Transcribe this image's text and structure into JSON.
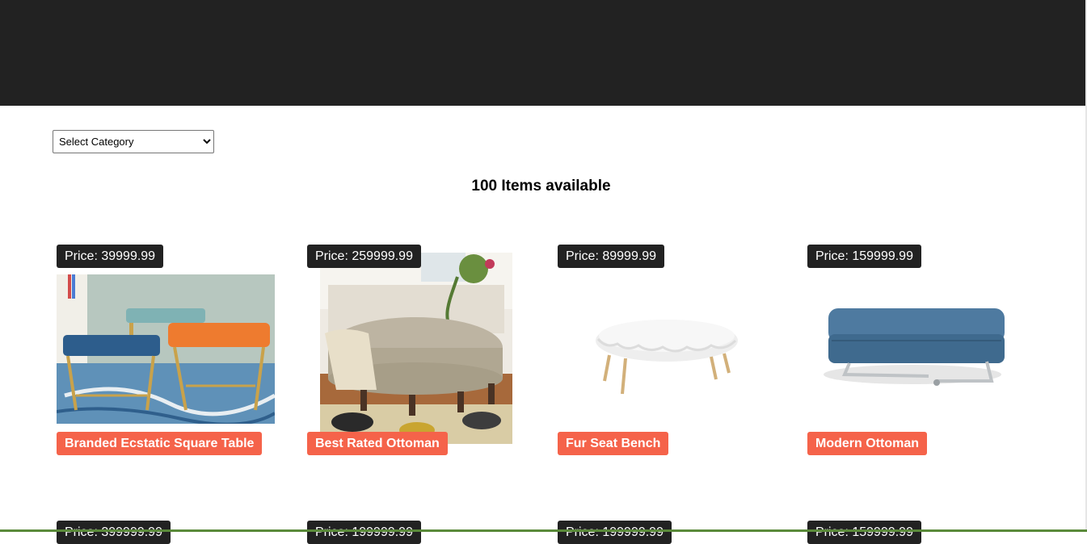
{
  "filter": {
    "selected": "Select Category"
  },
  "summary": {
    "items_available": "100 Items available"
  },
  "products": [
    {
      "price": "Price: 39999.99",
      "name": "Branded Ecstatic Square Table",
      "image": "teal-and-orange-tufted-stools"
    },
    {
      "price": "Price: 259999.99",
      "name": "Best Rated Ottoman",
      "image": "oval-tufted-ottoman"
    },
    {
      "price": "Price: 89999.99",
      "name": "Fur Seat Bench",
      "image": "white-fur-bench"
    },
    {
      "price": "Price: 159999.99",
      "name": "Modern Ottoman",
      "image": "blue-square-ottoman"
    }
  ],
  "next_row_prices": [
    "Price: 399999.99",
    "Price: 199999.99",
    "Price: 199999.99",
    "Price: 159999.99"
  ]
}
